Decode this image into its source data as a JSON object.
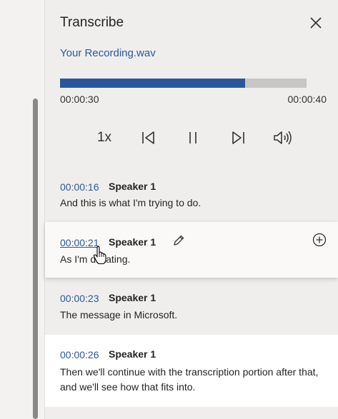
{
  "pane": {
    "title": "Transcribe",
    "close_icon": "close-icon"
  },
  "recording": {
    "file_name": "Your Recording.wav",
    "progress": 0.75,
    "current_time": "00:00:30",
    "total_time": "00:00:40"
  },
  "playback": {
    "speed_label": "1x",
    "icons": [
      "rewind-icon",
      "pause-icon",
      "fast-forward-icon",
      "volume-icon"
    ]
  },
  "transcript": [
    {
      "timestamp": "00:00:16",
      "speaker": "Speaker 1",
      "text": "And this is what I'm trying to do."
    },
    {
      "timestamp": "00:00:21",
      "speaker": "Speaker 1",
      "text": "As I'm dictating."
    },
    {
      "timestamp": "00:00:23",
      "speaker": "Speaker 1",
      "text": "The message in Microsoft."
    },
    {
      "timestamp": "00:00:26",
      "speaker": "Speaker 1",
      "text": "Then we'll continue with the transcription portion after that, and we'll see how that fits into."
    }
  ],
  "colors": {
    "accent": "#2b579a",
    "pane_background": "#efeeec",
    "highlight_background": "#ffffff"
  }
}
